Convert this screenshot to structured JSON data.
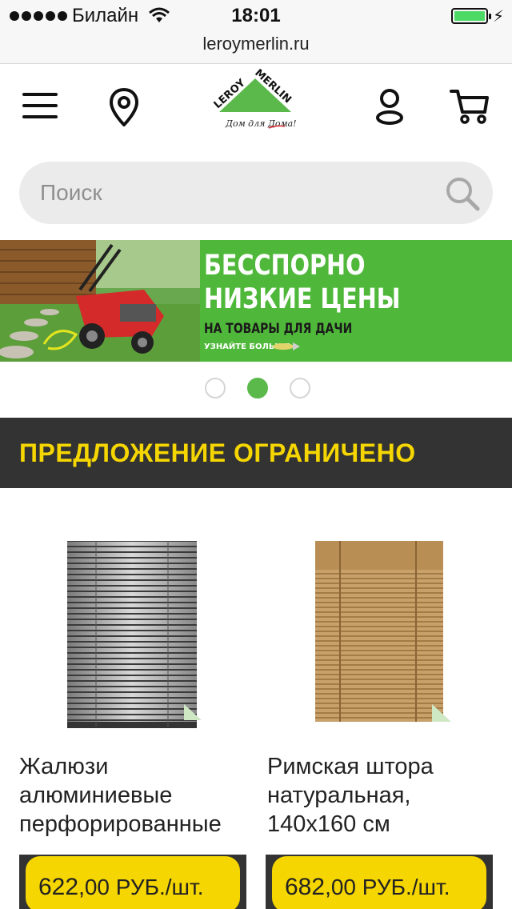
{
  "status_bar": {
    "carrier": "Билайн",
    "time": "18:01",
    "battery_level": 1.0
  },
  "url_bar": {
    "url": "leroymerlin.ru"
  },
  "header": {
    "icons": [
      "menu-icon",
      "location-pin-icon",
      "user-icon",
      "cart-icon"
    ],
    "logo": {
      "line1": "LEROY",
      "line2": "MERLIN",
      "slogan": "Дом для Дома!"
    }
  },
  "search": {
    "placeholder": "Поиск"
  },
  "banner": {
    "headline_1": "БЕССПОРНО",
    "headline_2": "НИЗКИЕ ЦЕНЫ",
    "subline": "НА ТОВАРЫ ДЛЯ ДАЧИ",
    "more": "УЗНАЙТЕ БОЛЬШЕ"
  },
  "carousel": {
    "total": 3,
    "active_index": 1
  },
  "offer": {
    "title": "ПРЕДЛОЖЕНИЕ ОГРАНИЧЕНО"
  },
  "colors": {
    "brand_green": "#5ab94a",
    "accent_yellow": "#f6d600",
    "dark_bar": "#333333"
  },
  "products": [
    {
      "name_lines": [
        "Жалюзи",
        "алюминиевые",
        "перфорированные"
      ],
      "price_int": "622",
      "price_frac": ",00",
      "price_unit": " РУБ./шт."
    },
    {
      "name_lines": [
        "Римская штора",
        "натуральная,",
        "140x160 см"
      ],
      "price_int": "682",
      "price_frac": ",00",
      "price_unit": " РУБ./шт."
    }
  ]
}
